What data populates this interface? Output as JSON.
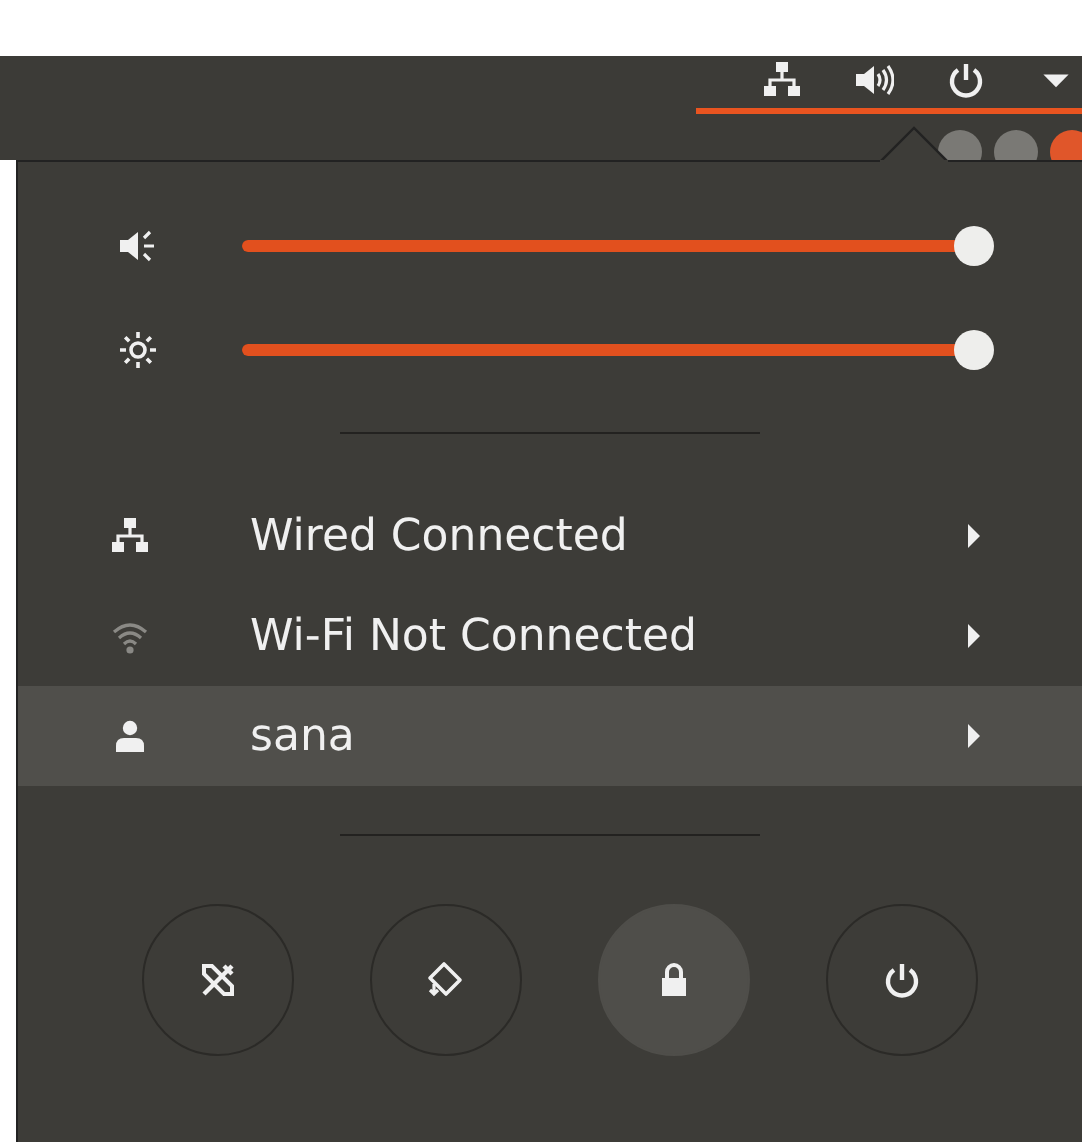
{
  "top_bar": {
    "indicators": [
      {
        "kind": "network"
      },
      {
        "kind": "volume"
      },
      {
        "kind": "power"
      },
      {
        "kind": "caret"
      }
    ]
  },
  "sliders": [
    {
      "kind": "volume",
      "level": 1.0
    },
    {
      "kind": "brightness",
      "level": 1.0
    }
  ],
  "menu_items": [
    {
      "kind": "wired",
      "label": "Wired Connected",
      "selected": false
    },
    {
      "kind": "wifi",
      "label": "Wi-Fi Not Connected",
      "selected": false
    },
    {
      "kind": "user",
      "label": "sana",
      "selected": true
    }
  ],
  "action_buttons": [
    {
      "kind": "settings",
      "selected": false
    },
    {
      "kind": "rotation",
      "selected": false
    },
    {
      "kind": "lock",
      "selected": true
    },
    {
      "kind": "power",
      "selected": false
    }
  ]
}
